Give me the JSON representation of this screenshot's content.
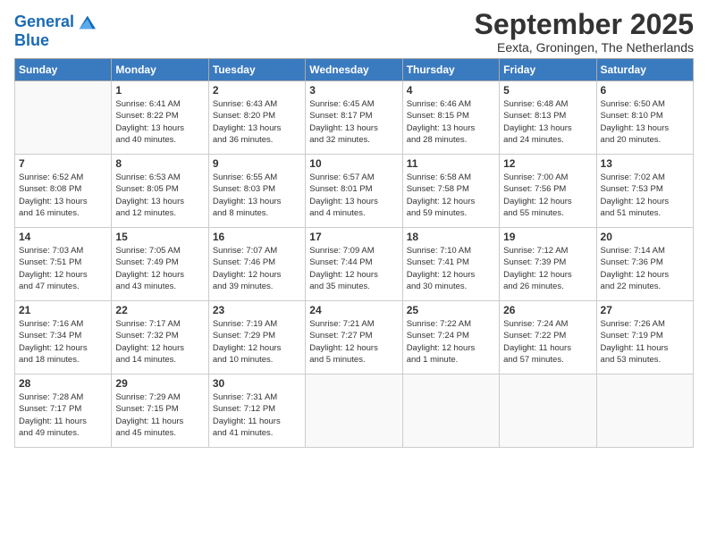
{
  "logo": {
    "line1": "General",
    "line2": "Blue"
  },
  "title": "September 2025",
  "location": "Eexta, Groningen, The Netherlands",
  "weekdays": [
    "Sunday",
    "Monday",
    "Tuesday",
    "Wednesday",
    "Thursday",
    "Friday",
    "Saturday"
  ],
  "weeks": [
    [
      {
        "day": "",
        "info": ""
      },
      {
        "day": "1",
        "info": "Sunrise: 6:41 AM\nSunset: 8:22 PM\nDaylight: 13 hours\nand 40 minutes."
      },
      {
        "day": "2",
        "info": "Sunrise: 6:43 AM\nSunset: 8:20 PM\nDaylight: 13 hours\nand 36 minutes."
      },
      {
        "day": "3",
        "info": "Sunrise: 6:45 AM\nSunset: 8:17 PM\nDaylight: 13 hours\nand 32 minutes."
      },
      {
        "day": "4",
        "info": "Sunrise: 6:46 AM\nSunset: 8:15 PM\nDaylight: 13 hours\nand 28 minutes."
      },
      {
        "day": "5",
        "info": "Sunrise: 6:48 AM\nSunset: 8:13 PM\nDaylight: 13 hours\nand 24 minutes."
      },
      {
        "day": "6",
        "info": "Sunrise: 6:50 AM\nSunset: 8:10 PM\nDaylight: 13 hours\nand 20 minutes."
      }
    ],
    [
      {
        "day": "7",
        "info": "Sunrise: 6:52 AM\nSunset: 8:08 PM\nDaylight: 13 hours\nand 16 minutes."
      },
      {
        "day": "8",
        "info": "Sunrise: 6:53 AM\nSunset: 8:05 PM\nDaylight: 13 hours\nand 12 minutes."
      },
      {
        "day": "9",
        "info": "Sunrise: 6:55 AM\nSunset: 8:03 PM\nDaylight: 13 hours\nand 8 minutes."
      },
      {
        "day": "10",
        "info": "Sunrise: 6:57 AM\nSunset: 8:01 PM\nDaylight: 13 hours\nand 4 minutes."
      },
      {
        "day": "11",
        "info": "Sunrise: 6:58 AM\nSunset: 7:58 PM\nDaylight: 12 hours\nand 59 minutes."
      },
      {
        "day": "12",
        "info": "Sunrise: 7:00 AM\nSunset: 7:56 PM\nDaylight: 12 hours\nand 55 minutes."
      },
      {
        "day": "13",
        "info": "Sunrise: 7:02 AM\nSunset: 7:53 PM\nDaylight: 12 hours\nand 51 minutes."
      }
    ],
    [
      {
        "day": "14",
        "info": "Sunrise: 7:03 AM\nSunset: 7:51 PM\nDaylight: 12 hours\nand 47 minutes."
      },
      {
        "day": "15",
        "info": "Sunrise: 7:05 AM\nSunset: 7:49 PM\nDaylight: 12 hours\nand 43 minutes."
      },
      {
        "day": "16",
        "info": "Sunrise: 7:07 AM\nSunset: 7:46 PM\nDaylight: 12 hours\nand 39 minutes."
      },
      {
        "day": "17",
        "info": "Sunrise: 7:09 AM\nSunset: 7:44 PM\nDaylight: 12 hours\nand 35 minutes."
      },
      {
        "day": "18",
        "info": "Sunrise: 7:10 AM\nSunset: 7:41 PM\nDaylight: 12 hours\nand 30 minutes."
      },
      {
        "day": "19",
        "info": "Sunrise: 7:12 AM\nSunset: 7:39 PM\nDaylight: 12 hours\nand 26 minutes."
      },
      {
        "day": "20",
        "info": "Sunrise: 7:14 AM\nSunset: 7:36 PM\nDaylight: 12 hours\nand 22 minutes."
      }
    ],
    [
      {
        "day": "21",
        "info": "Sunrise: 7:16 AM\nSunset: 7:34 PM\nDaylight: 12 hours\nand 18 minutes."
      },
      {
        "day": "22",
        "info": "Sunrise: 7:17 AM\nSunset: 7:32 PM\nDaylight: 12 hours\nand 14 minutes."
      },
      {
        "day": "23",
        "info": "Sunrise: 7:19 AM\nSunset: 7:29 PM\nDaylight: 12 hours\nand 10 minutes."
      },
      {
        "day": "24",
        "info": "Sunrise: 7:21 AM\nSunset: 7:27 PM\nDaylight: 12 hours\nand 5 minutes."
      },
      {
        "day": "25",
        "info": "Sunrise: 7:22 AM\nSunset: 7:24 PM\nDaylight: 12 hours\nand 1 minute."
      },
      {
        "day": "26",
        "info": "Sunrise: 7:24 AM\nSunset: 7:22 PM\nDaylight: 11 hours\nand 57 minutes."
      },
      {
        "day": "27",
        "info": "Sunrise: 7:26 AM\nSunset: 7:19 PM\nDaylight: 11 hours\nand 53 minutes."
      }
    ],
    [
      {
        "day": "28",
        "info": "Sunrise: 7:28 AM\nSunset: 7:17 PM\nDaylight: 11 hours\nand 49 minutes."
      },
      {
        "day": "29",
        "info": "Sunrise: 7:29 AM\nSunset: 7:15 PM\nDaylight: 11 hours\nand 45 minutes."
      },
      {
        "day": "30",
        "info": "Sunrise: 7:31 AM\nSunset: 7:12 PM\nDaylight: 11 hours\nand 41 minutes."
      },
      {
        "day": "",
        "info": ""
      },
      {
        "day": "",
        "info": ""
      },
      {
        "day": "",
        "info": ""
      },
      {
        "day": "",
        "info": ""
      }
    ]
  ]
}
